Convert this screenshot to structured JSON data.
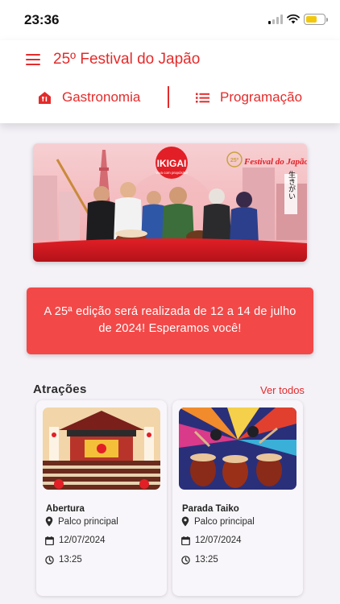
{
  "status_bar": {
    "time": "23:36"
  },
  "header": {
    "title": "25º Festival do Japão",
    "tabs": [
      {
        "label": "Gastronomia",
        "icon": "restaurant-icon"
      },
      {
        "label": "Programação",
        "icon": "list-icon"
      }
    ]
  },
  "banner": {
    "badge": "IKIGAI",
    "badge_tagline": "Viva com propósito!",
    "logo_prefix": "25º",
    "logo_text": "Festival do Japão",
    "vertical_text": "生きがい"
  },
  "notice": {
    "text": "A 25ª edição será realizada de 12 a 14 de julho de 2024! Esperamos você!"
  },
  "attractions": {
    "title": "Atrações",
    "see_all": "Ver todos",
    "items": [
      {
        "name": "Abertura",
        "place": "Palco principal",
        "date": "12/07/2024",
        "time": "13:25"
      },
      {
        "name": "Parada Taiko",
        "place": "Palco principal",
        "date": "12/07/2024",
        "time": "13:25"
      }
    ]
  },
  "colors": {
    "accent": "#e42b2b",
    "notice_bg": "#f34848",
    "page_bg": "#f4f1f7"
  }
}
